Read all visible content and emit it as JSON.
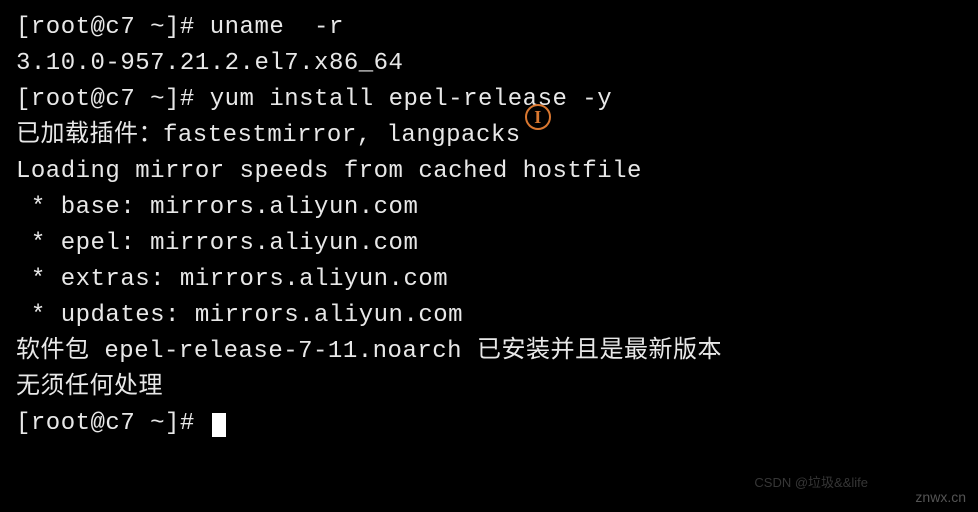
{
  "terminal": {
    "prompt": "[root@c7 ~]# ",
    "lines": [
      {
        "prompt": true,
        "cmd": "uname  -r"
      },
      {
        "prompt": false,
        "text": "3.10.0-957.21.2.el7.x86_64"
      },
      {
        "prompt": true,
        "cmd": "yum install epel-release -y"
      },
      {
        "prompt": false,
        "text": "已加载插件：fastestmirror, langpacks"
      },
      {
        "prompt": false,
        "text": "Loading mirror speeds from cached hostfile"
      },
      {
        "prompt": false,
        "text": " * base: mirrors.aliyun.com"
      },
      {
        "prompt": false,
        "text": " * epel: mirrors.aliyun.com"
      },
      {
        "prompt": false,
        "text": " * extras: mirrors.aliyun.com"
      },
      {
        "prompt": false,
        "text": " * updates: mirrors.aliyun.com"
      },
      {
        "prompt": false,
        "text": "软件包 epel-release-7-11.noarch 已安装并且是最新版本"
      },
      {
        "prompt": false,
        "text": "无须任何处理"
      },
      {
        "prompt": true,
        "cmd": "",
        "cursor": true
      }
    ]
  },
  "watermarks": {
    "w1": "znwx.cn",
    "w2": "CSDN @垃圾&&life"
  }
}
